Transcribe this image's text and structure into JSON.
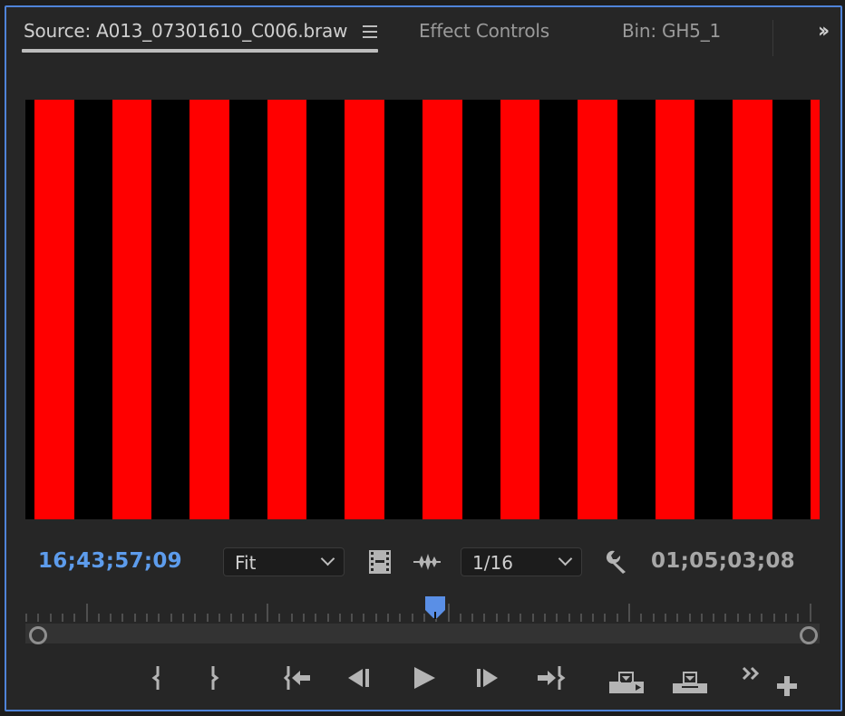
{
  "tabs": [
    {
      "label": "Source: A013_07301610_C006.braw",
      "active": true
    },
    {
      "label": "Effect Controls",
      "active": false
    },
    {
      "label": "Bin: GH5_1",
      "active": false
    }
  ],
  "tab_menu_icon": "hamburger-menu-icon",
  "tab_overflow_icon": "double-chevron-right-icon",
  "viewer": {
    "content": "red and black vertical stripes",
    "stripe_color": "#ff0000",
    "background_color": "#000000",
    "red_stripe_count": 11
  },
  "controls": {
    "current_timecode": "16;43;57;09",
    "duration_timecode": "01;05;03;08",
    "zoom_select": {
      "value": "Fit"
    },
    "resolution_select": {
      "value": "1/16"
    },
    "icons": {
      "drag_video": "film-strip-icon",
      "drag_audio": "audio-waveform-icon",
      "settings": "wrench-icon"
    },
    "colors": {
      "accent": "#5d9cec",
      "panel_border": "#4f83d8",
      "text_muted": "#a7a7a7"
    }
  },
  "scrubber": {
    "playhead_position_fraction": 0.52,
    "zoom_range": [
      0.0,
      1.0
    ]
  },
  "transport_buttons": [
    {
      "name": "mark-in",
      "icon": "mark-in-icon"
    },
    {
      "name": "mark-out",
      "icon": "mark-out-icon"
    },
    {
      "name": "go-to-in",
      "icon": "go-to-in-icon"
    },
    {
      "name": "step-back",
      "icon": "step-back-icon"
    },
    {
      "name": "play",
      "icon": "play-icon"
    },
    {
      "name": "step-forward",
      "icon": "step-forward-icon"
    },
    {
      "name": "go-to-out",
      "icon": "go-to-out-icon"
    },
    {
      "name": "insert",
      "icon": "insert-icon"
    },
    {
      "name": "overwrite",
      "icon": "overwrite-icon"
    },
    {
      "name": "more",
      "icon": "double-chevron-right-icon"
    },
    {
      "name": "button-editor",
      "icon": "plus-icon"
    }
  ]
}
